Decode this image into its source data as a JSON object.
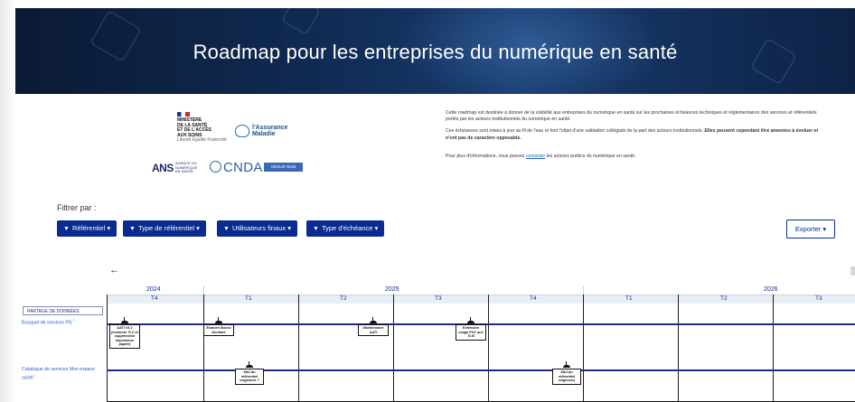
{
  "hero": {
    "title": "Roadmap pour les entreprises du numérique en santé"
  },
  "logos": {
    "ministere": [
      "MINISTÈRE",
      "DE LA SANTÉ",
      "ET DE L'ACCÈS",
      "AUX SOINS"
    ],
    "ministere_motto": "Liberté Égalité Fraternité",
    "assurance": [
      "l'Assurance",
      "Maladie"
    ],
    "ans": "ANS",
    "ans_sub": "AGENCE DU NUMÉRIQUE EN SANTÉ",
    "cnda": "CNDA",
    "segur": "SEGUR NUM"
  },
  "intro": {
    "p1": "Cette roadmap est destinée à donner de la visibilité aux entreprises du numérique en santé sur les prochaines échéances techniques et réglementaires des services et référentiels portés par les acteurs institutionnels du numérique en santé.",
    "p2a": "Ces échéances sont mises à jour au fil de l'eau et font l'objet d'une validation collégiale de la part des acteurs institutionnels. ",
    "p2b": "Elles peuvent cependant être amenées à évoluer et n'ont pas de caractère opposable.",
    "p3a": "Pour plus d'informations, vous pouvez ",
    "p3link": "contacter",
    "p3b": " les acteurs publics du numérique en santé."
  },
  "filters": {
    "label": "Filtrer par :",
    "buttons": [
      "Référentiel",
      "Type de référentiel",
      "Utilisateurs finaux",
      "Type d'échéance"
    ],
    "export": "Exporter"
  },
  "timeline": {
    "years": [
      "2024",
      "2025",
      "2026"
    ],
    "quarters": [
      "T4",
      "T1",
      "T2",
      "T3",
      "T4",
      "T1",
      "T2",
      "T3"
    ],
    "category": "PARTAGE DE DONNÉES",
    "rows": [
      {
        "label": "Bouquet de services PS",
        "events": [
          "AATI V3.1 (contexte TLC et suppression impression papier)",
          "Examen Bucco Dentaire",
          "Maintenance AATI",
          "Extension usage PSC aux TLM"
        ]
      },
      {
        "label": "Catalogue de services Mon espace santé",
        "events": [
          "MàJ du référentiel exigences ?",
          "MàJ du référentiel exigences"
        ]
      }
    ]
  },
  "colors": {
    "primary": "#0a2b8f",
    "hero_bg": "#102a52",
    "link": "#2962c6"
  }
}
